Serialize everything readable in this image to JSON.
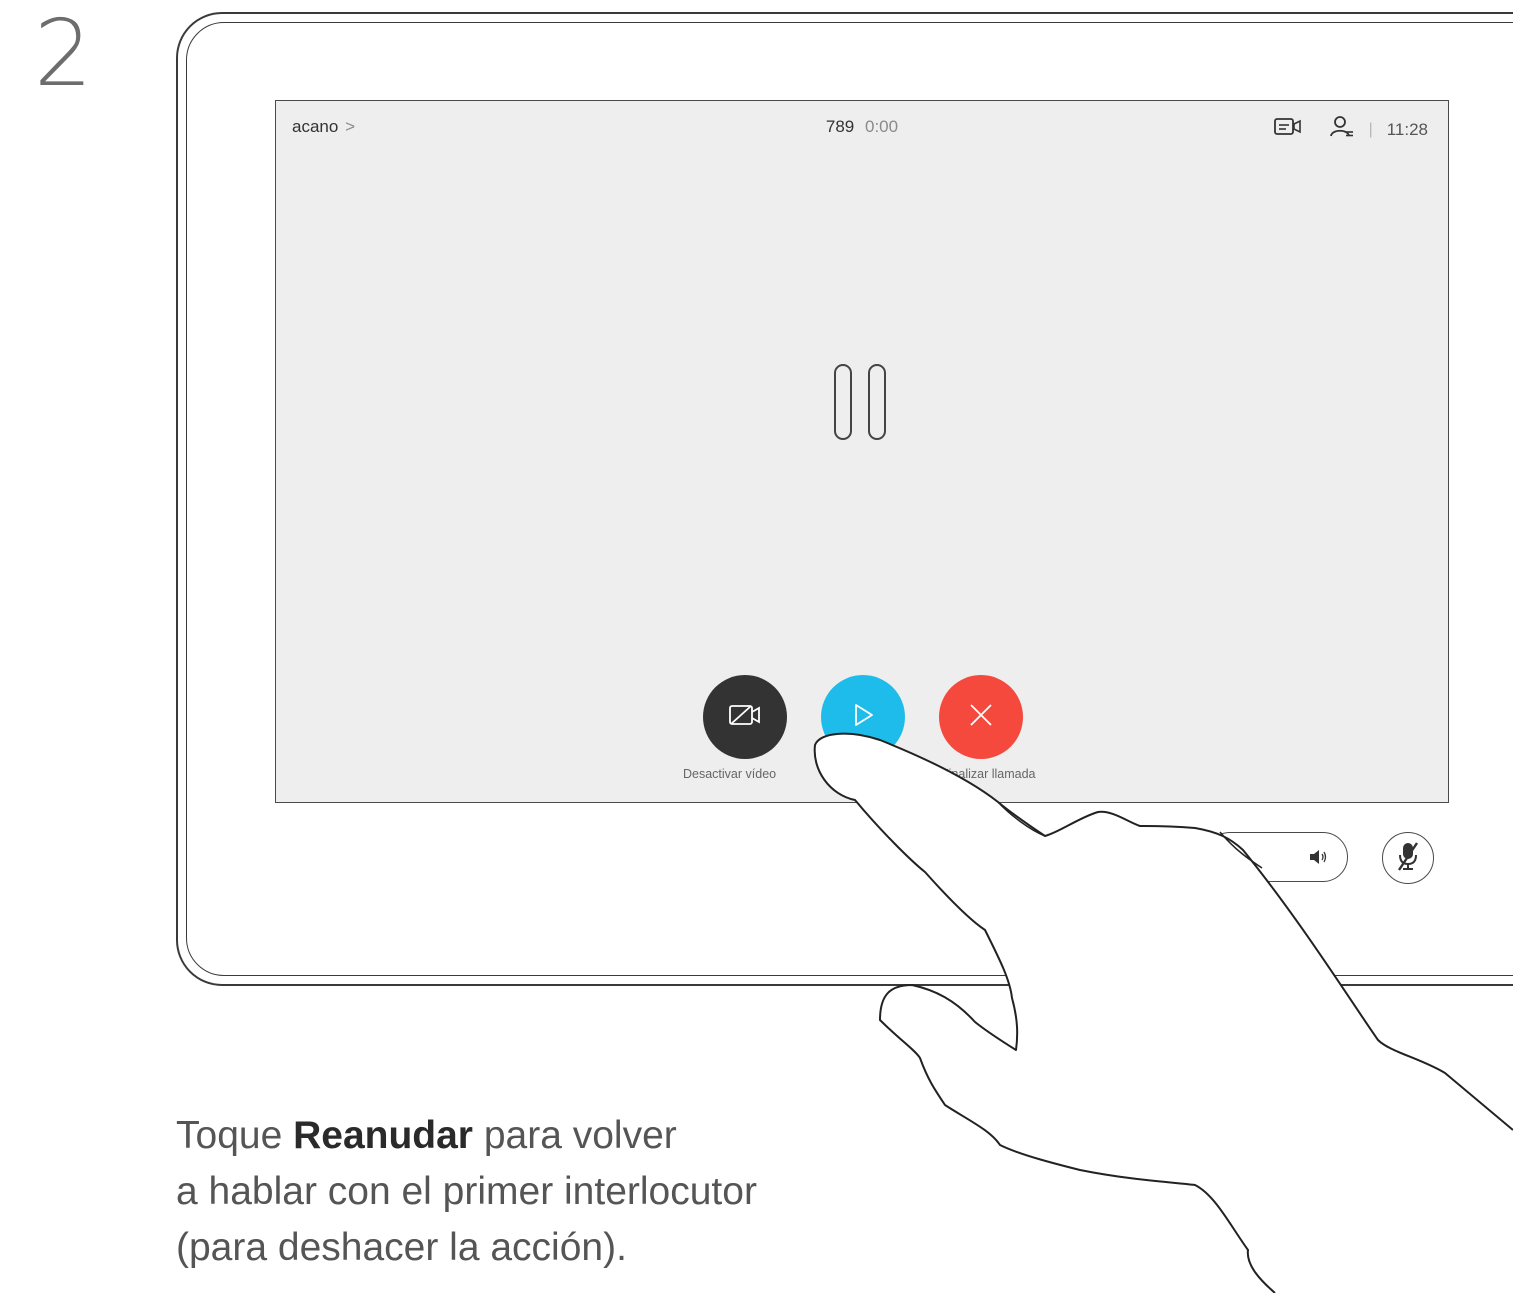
{
  "step": "2",
  "call": {
    "caller_name": "acano",
    "caller_chevron": ">",
    "number": "789",
    "duration": "0:00",
    "separator": "|",
    "clock": "11:28"
  },
  "controls": {
    "video_label": "Desactivar vídeo",
    "end_label": "Finalizar llamada"
  },
  "instruction": {
    "prefix": "Toque ",
    "highlight": "Reanudar",
    "line1_rest": " para volver",
    "line2": "a hablar con el primer interlocutor",
    "line3": "(para deshacer la acción)."
  },
  "colors": {
    "resume": "#1ebcea",
    "end_call": "#f5493d",
    "video_off": "#333333",
    "screen_bg": "#eeeeee"
  },
  "icons": {
    "video": "camera-off-icon",
    "resume": "play-icon",
    "end": "close-icon",
    "volume": "speaker-icon",
    "mute": "microphone-muted-icon",
    "layout": "layout-icon",
    "participants": "participants-icon",
    "hold": "pause-icon"
  }
}
